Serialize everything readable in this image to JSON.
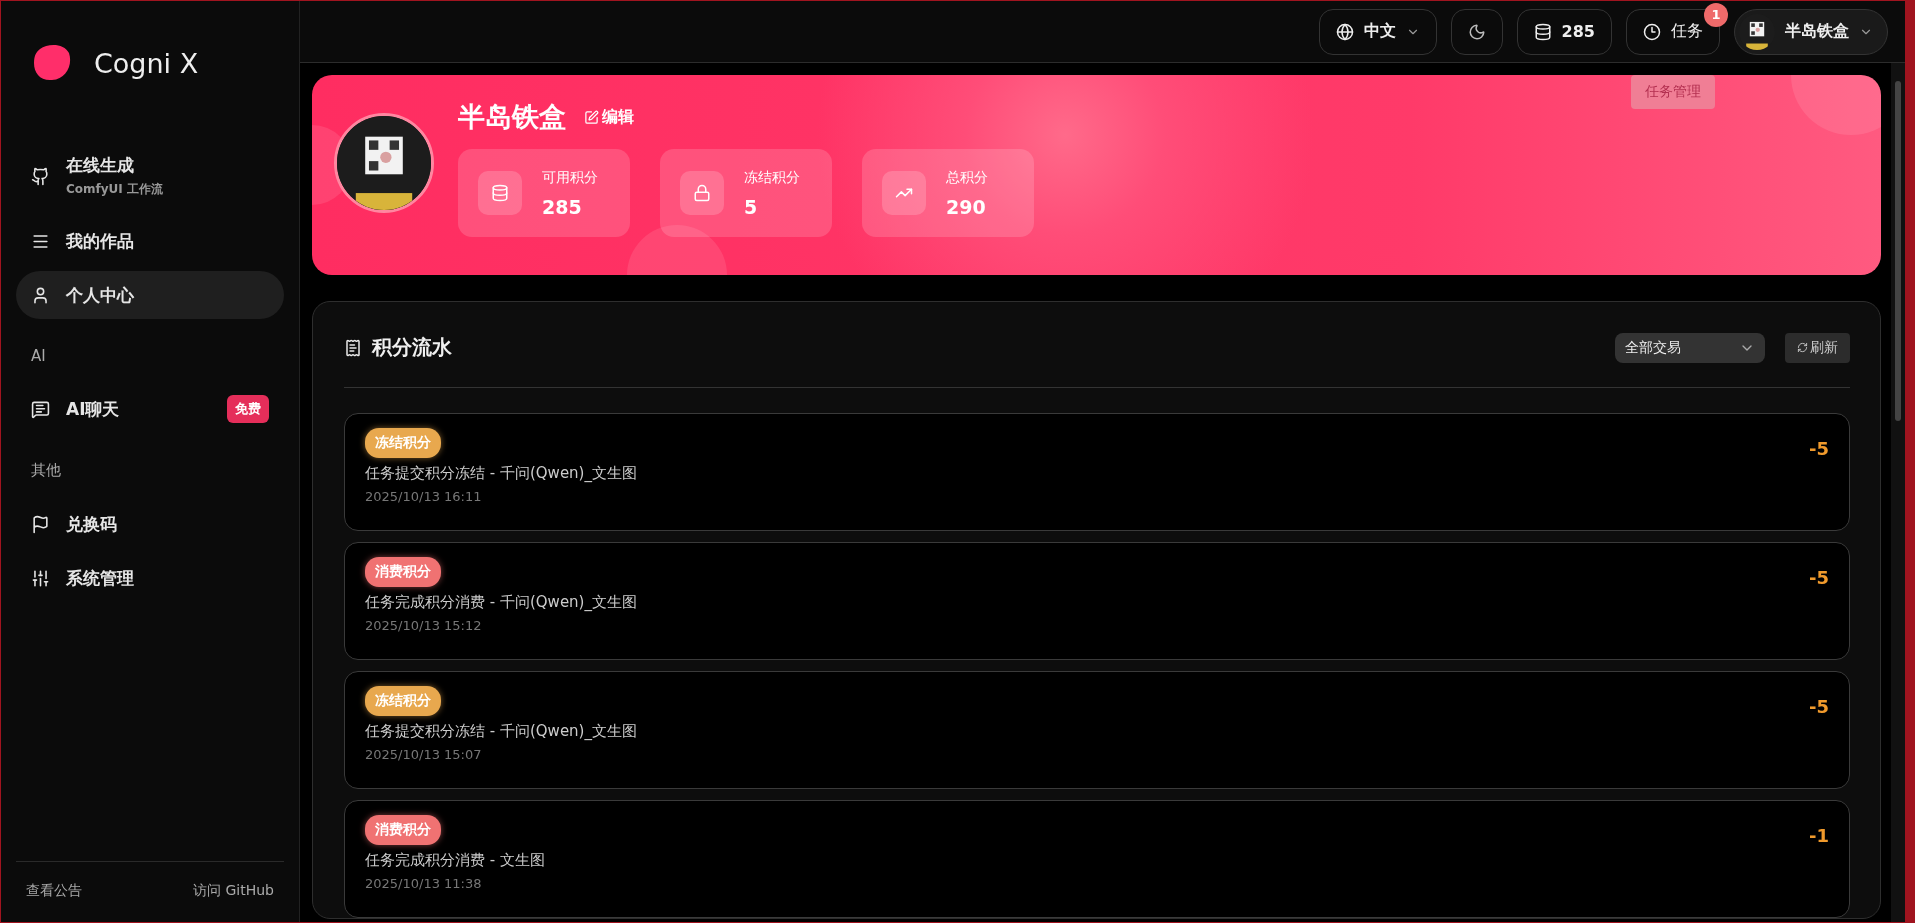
{
  "app": {
    "name": "Cogni X"
  },
  "sidebar": {
    "sections": [
      {
        "items": [
          {
            "label": "在线生成",
            "sublabel": "ComfyUI 工作流",
            "selected": false
          },
          {
            "label": "我的作品",
            "selected": false
          },
          {
            "label": "个人中心",
            "selected": true
          }
        ]
      },
      {
        "title": "AI",
        "items": [
          {
            "label": "AI聊天",
            "badge": "免费",
            "selected": false
          }
        ]
      },
      {
        "title": "其他",
        "items": [
          {
            "label": "兑换码",
            "selected": false
          },
          {
            "label": "系统管理",
            "selected": false
          }
        ]
      }
    ],
    "footer": [
      "查看公告",
      "访问 GitHub"
    ]
  },
  "topbar": {
    "language": "中文",
    "credits": "285",
    "tasks": "任务",
    "tasks_badge": "1",
    "tooltip": "任务管理",
    "user": "半岛铁盒"
  },
  "profile": {
    "name": "半岛铁盒",
    "edit": "编辑",
    "stats": [
      {
        "label": "可用积分",
        "value": "285"
      },
      {
        "label": "冻结积分",
        "value": "5"
      },
      {
        "label": "总积分",
        "value": "290"
      }
    ]
  },
  "ledger": {
    "title": "积分流水",
    "filter": "全部交易",
    "refresh": "刷新",
    "entries": [
      {
        "kind": "freeze",
        "tag": "冻结积分",
        "description": "任务提交积分冻结 - 千问(Qwen)_文生图",
        "time": "2025/10/13 16:11",
        "amount": "-5"
      },
      {
        "kind": "spend",
        "tag": "消费积分",
        "description": "任务完成积分消费 - 千问(Qwen)_文生图",
        "time": "2025/10/13 15:12",
        "amount": "-5"
      },
      {
        "kind": "freeze",
        "tag": "冻结积分",
        "description": "任务提交积分冻结 - 千问(Qwen)_文生图",
        "time": "2025/10/13 15:07",
        "amount": "-5"
      },
      {
        "kind": "spend",
        "tag": "消费积分",
        "description": "任务完成积分消费 - 文生图",
        "time": "2025/10/13 11:38",
        "amount": "-1"
      }
    ]
  }
}
